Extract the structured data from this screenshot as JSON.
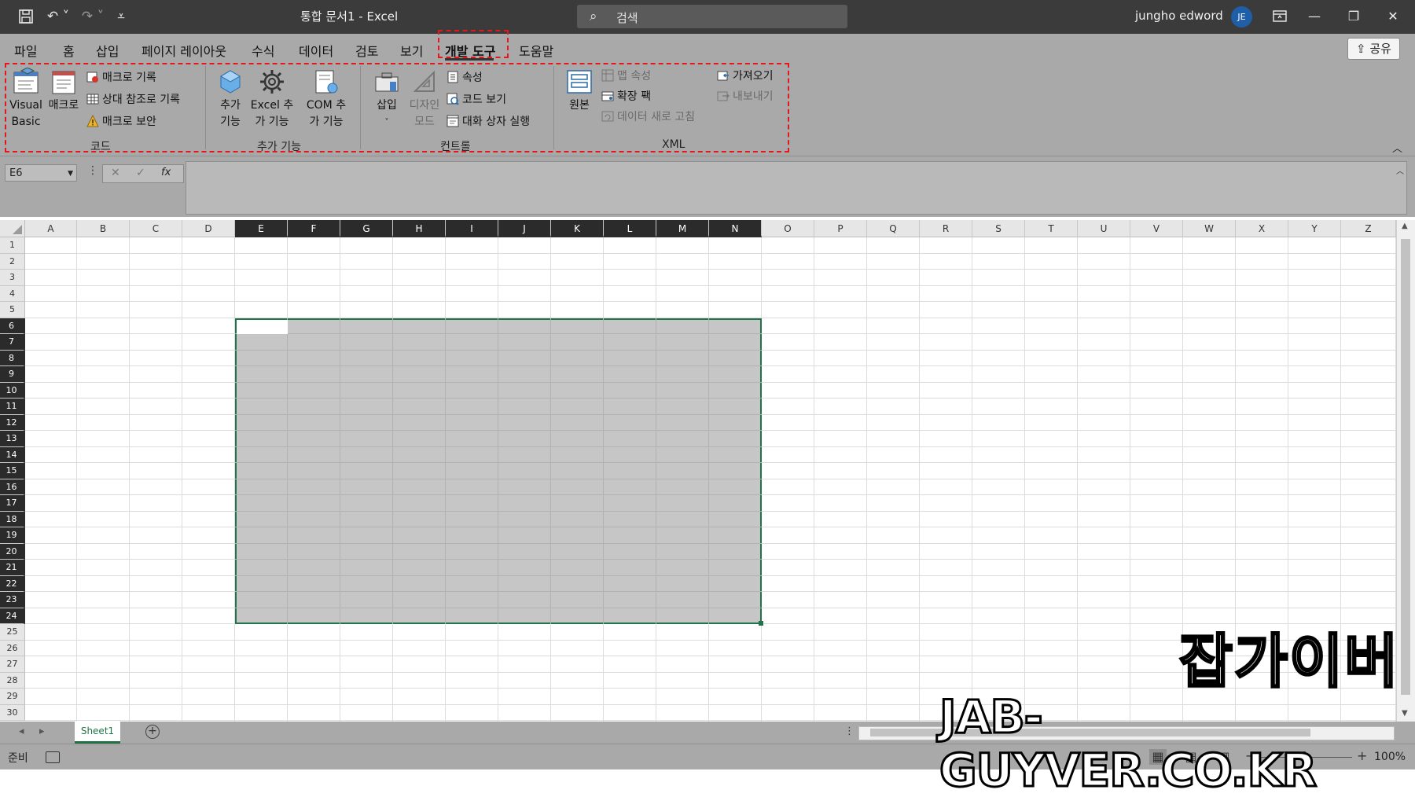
{
  "titlebar": {
    "document_title": "통합 문서1  -  Excel",
    "search_placeholder": "검색",
    "user_name": "jungho edword",
    "user_initials": "JE"
  },
  "tabs": [
    {
      "label": "파일"
    },
    {
      "label": "홈"
    },
    {
      "label": "삽입"
    },
    {
      "label": "페이지 레이아웃"
    },
    {
      "label": "수식"
    },
    {
      "label": "데이터"
    },
    {
      "label": "검토"
    },
    {
      "label": "보기"
    },
    {
      "label": "개발 도구",
      "active": true
    },
    {
      "label": "도움말"
    }
  ],
  "share_label": "공유",
  "ribbon": {
    "code": {
      "group_label": "코드",
      "visual_basic": "Visual Basic",
      "macros": "매크로",
      "record_macro": "매크로 기록",
      "relative_refs": "상대 참조로 기록",
      "macro_security": "매크로 보안"
    },
    "addins": {
      "group_label": "추가 기능",
      "addins": "추가 기능",
      "excel_addins": "Excel 추가 기능",
      "com_addins": "COM 추가 기능"
    },
    "controls": {
      "group_label": "컨트롤",
      "insert": "삽입",
      "design_mode": "디자인 모드",
      "properties": "속성",
      "view_code": "코드 보기",
      "run_dialog": "대화 상자 실행"
    },
    "xml": {
      "group_label": "XML",
      "source": "원본",
      "map_properties": "맵 속성",
      "expansion_packs": "확장 팩",
      "refresh_data": "데이터 새로 고침",
      "import": "가져오기",
      "export": "내보내기"
    }
  },
  "formula_bar": {
    "name_box": "E6",
    "cancel": "✕",
    "enter": "✓",
    "fx": "fx",
    "value": ""
  },
  "grid": {
    "columns": [
      "A",
      "B",
      "C",
      "D",
      "E",
      "F",
      "G",
      "H",
      "I",
      "J",
      "K",
      "L",
      "M",
      "N",
      "O",
      "P",
      "Q",
      "R",
      "S",
      "T",
      "U",
      "V",
      "W",
      "X",
      "Y",
      "Z"
    ],
    "rows": [
      "1",
      "2",
      "3",
      "4",
      "5",
      "6",
      "7",
      "8",
      "9",
      "10",
      "11",
      "12",
      "13",
      "14",
      "15",
      "16",
      "17",
      "18",
      "19",
      "20",
      "21",
      "22",
      "23",
      "24",
      "25",
      "26",
      "27",
      "28",
      "29",
      "30"
    ],
    "selected_range": "E6:N24",
    "active_cell": "E6"
  },
  "sheets": [
    {
      "name": "Sheet1",
      "active": true
    }
  ],
  "status": {
    "ready": "준비",
    "zoom": "100%"
  },
  "watermark": {
    "korean": "잡가이버",
    "english": "JAB-GUYVER.CO.KR"
  },
  "colors": {
    "titlebar": "#3b3b3b",
    "ribbon": "#a9a9a9",
    "selection_border": "#21734a",
    "highlight_dash": "#e3171c",
    "avatar": "#1f5fa8"
  }
}
